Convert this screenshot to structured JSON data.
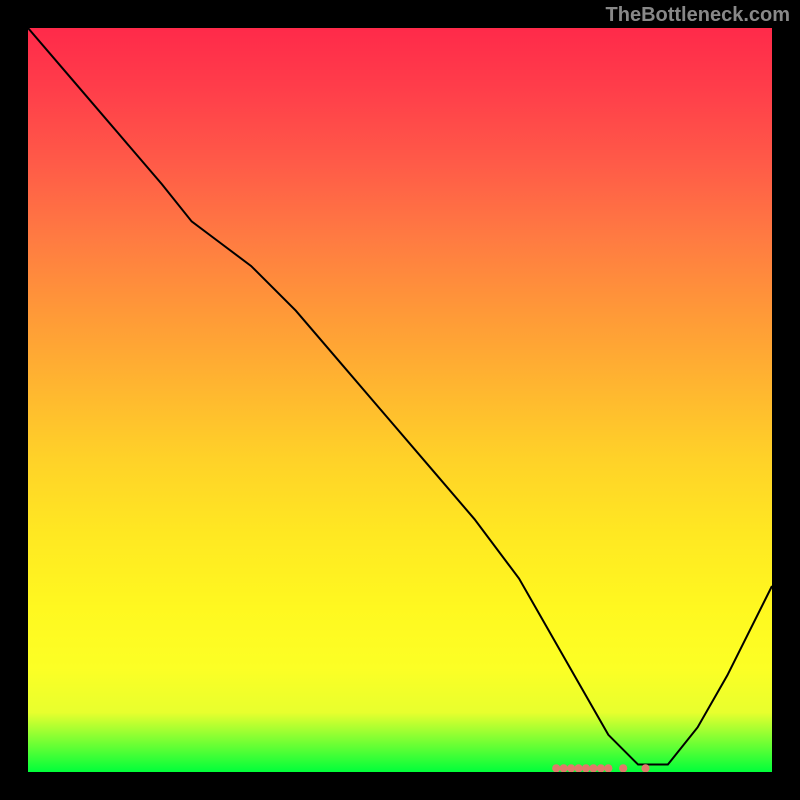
{
  "watermark": "TheBottleneck.com",
  "chart_data": {
    "type": "line",
    "title": "",
    "xlabel": "",
    "ylabel": "",
    "xlim": [
      0,
      100
    ],
    "ylim": [
      0,
      100
    ],
    "series": [
      {
        "name": "curve",
        "x": [
          0,
          6,
          12,
          18,
          22,
          26,
          30,
          36,
          42,
          48,
          54,
          60,
          66,
          70,
          74,
          78,
          82,
          86,
          90,
          94,
          100
        ],
        "y": [
          100,
          93,
          86,
          79,
          74,
          71,
          68,
          62,
          55,
          48,
          41,
          34,
          26,
          19,
          12,
          5,
          1,
          1,
          6,
          13,
          25
        ]
      }
    ],
    "markers": {
      "name": "bottom-dots",
      "x": [
        71,
        72,
        73,
        74,
        75,
        76,
        77,
        78,
        80,
        83
      ],
      "y": [
        0.5,
        0.5,
        0.5,
        0.5,
        0.5,
        0.5,
        0.5,
        0.5,
        0.5,
        0.5
      ]
    }
  }
}
